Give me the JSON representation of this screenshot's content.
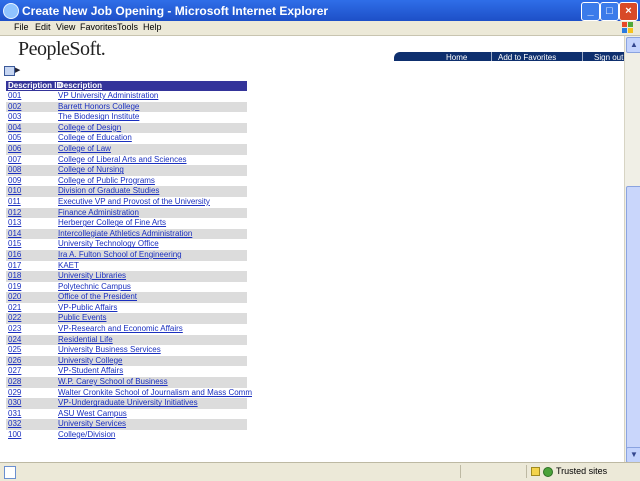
{
  "window": {
    "title": "Create New Job Opening - Microsoft Internet Explorer"
  },
  "menu": [
    "File",
    "Edit",
    "View",
    "Favorites",
    "Tools",
    "Help"
  ],
  "brand": "PeopleSoft.",
  "nav": {
    "home": "Home",
    "favorites": "Add to Favorites",
    "signout": "Sign out"
  },
  "grid": {
    "headers": {
      "id": "Description ID",
      "desc": "Description"
    },
    "rows": [
      {
        "id": "001",
        "desc": "VP University Administration"
      },
      {
        "id": "002",
        "desc": "Barrett Honors College"
      },
      {
        "id": "003",
        "desc": "The Biodesign Institute"
      },
      {
        "id": "004",
        "desc": "College of Design"
      },
      {
        "id": "005",
        "desc": "College of Education"
      },
      {
        "id": "006",
        "desc": "College of Law"
      },
      {
        "id": "007",
        "desc": "College of Liberal Arts and Sciences"
      },
      {
        "id": "008",
        "desc": "College of Nursing"
      },
      {
        "id": "009",
        "desc": "College of Public Programs"
      },
      {
        "id": "010",
        "desc": "Division of Graduate Studies"
      },
      {
        "id": "011",
        "desc": "Executive VP and Provost of the University"
      },
      {
        "id": "012",
        "desc": "Finance Administration"
      },
      {
        "id": "013",
        "desc": "Herberger College of Fine Arts"
      },
      {
        "id": "014",
        "desc": "Intercollegiate Athletics Administration"
      },
      {
        "id": "015",
        "desc": "University Technology Office"
      },
      {
        "id": "016",
        "desc": "Ira A. Fulton School of Engineering"
      },
      {
        "id": "017",
        "desc": "KAET"
      },
      {
        "id": "018",
        "desc": "University Libraries"
      },
      {
        "id": "019",
        "desc": "Polytechnic Campus"
      },
      {
        "id": "020",
        "desc": "Office of the President"
      },
      {
        "id": "021",
        "desc": "VP-Public Affairs"
      },
      {
        "id": "022",
        "desc": "Public Events"
      },
      {
        "id": "023",
        "desc": "VP-Research and Economic Affairs"
      },
      {
        "id": "024",
        "desc": "Residential Life"
      },
      {
        "id": "025",
        "desc": "University Business Services"
      },
      {
        "id": "026",
        "desc": "University College"
      },
      {
        "id": "027",
        "desc": "VP-Student Affairs"
      },
      {
        "id": "028",
        "desc": "W.P. Carey School of Business"
      },
      {
        "id": "029",
        "desc": "Walter Cronkite School of Journalism and Mass Comm"
      },
      {
        "id": "030",
        "desc": "VP-Undergraduate University Initiatives"
      },
      {
        "id": "031",
        "desc": "ASU West Campus"
      },
      {
        "id": "032",
        "desc": "University Services"
      },
      {
        "id": "100",
        "desc": "College/Division"
      }
    ]
  },
  "status": {
    "zone": "Trusted sites"
  },
  "colors": {
    "header": "#34349a",
    "link": "#1a2fbf",
    "nav_band": "#0e2f6e"
  }
}
